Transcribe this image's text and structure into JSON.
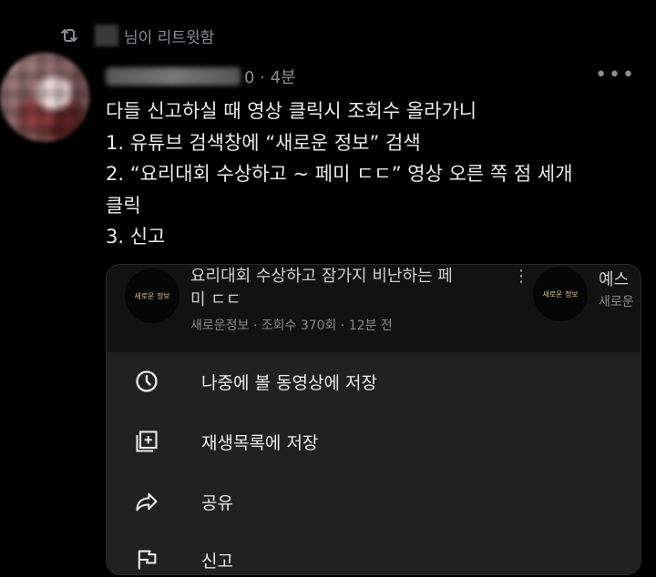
{
  "retweet": {
    "suffix": "님이 리트윗함"
  },
  "tweet": {
    "meta": "0 · 4분",
    "more": "•••",
    "lines": [
      "다들 신고하실 때 영상 클릭시 조회수 올라가니",
      "1. 유튜브 검색창에 “새로운 정보” 검색",
      "2. “요리대회 수상하고 ~ 페미 ㄷㄷ” 영상 오른 쪽 점 세개",
      "클릭",
      "3. 신고"
    ]
  },
  "video": {
    "channel_logo_text": "새로운 정보",
    "title_lines": [
      "요리대회 수상하고 잠가지 비난하는 페",
      "미 ㄷㄷ"
    ],
    "meta": "새로운정보 · 조회수 370회 · 12분 전",
    "kebab": "⋮",
    "right_title": "예스",
    "right_sub": "새로운"
  },
  "menu": {
    "items": [
      {
        "label": "나중에 볼 동영상에 저장",
        "icon": "clock-icon"
      },
      {
        "label": "재생목록에 저장",
        "icon": "playlist-add-icon"
      },
      {
        "label": "공유",
        "icon": "share-icon"
      },
      {
        "label": "신고",
        "icon": "flag-icon"
      }
    ]
  }
}
